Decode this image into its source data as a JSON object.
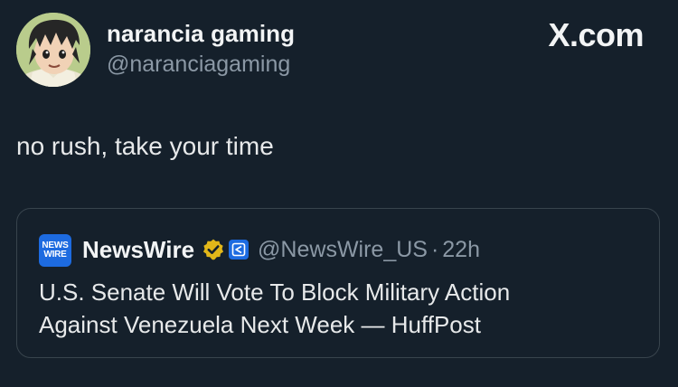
{
  "post": {
    "author": {
      "display_name": "narancia gaming",
      "handle": "@naranciagaming",
      "avatar_icon": "anime-avatar"
    },
    "watermark": "X.com",
    "text": "no rush, take your time"
  },
  "quote": {
    "logo_line1": "NEWS",
    "logo_line2": "WIRE",
    "author_name": "NewsWire",
    "handle": "@NewsWire_US",
    "separator": "·",
    "time": "22h",
    "line1": "U.S. Senate Will Vote To Block Military Action",
    "line2": "Against Venezuela Next Week — HuffPost",
    "verified_icon": "gold-verified-badge-icon",
    "affiliate_icon": "affiliate-badge-icon"
  },
  "colors": {
    "background": "#15202b",
    "text": "#e7e9ea",
    "muted": "#8b98a5",
    "border": "#38444d",
    "accent_blue": "#1d6be0",
    "gold": "#e2b719"
  }
}
